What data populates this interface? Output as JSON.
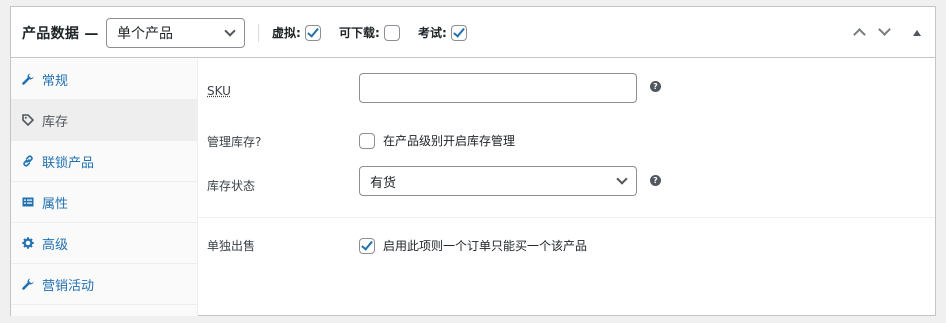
{
  "header": {
    "title": "产品数据 —",
    "product_type": "单个产品",
    "virtual_label": "虚拟:",
    "virtual_checked": true,
    "downloadable_label": "可下载:",
    "downloadable_checked": false,
    "test_label": "考试:",
    "test_checked": true
  },
  "sidebar": {
    "items": [
      {
        "label": "常规",
        "icon": "wrench-icon",
        "active": false
      },
      {
        "label": "库存",
        "icon": "tag-icon",
        "active": true
      },
      {
        "label": "联锁产品",
        "icon": "link-icon",
        "active": false
      },
      {
        "label": "属性",
        "icon": "list-icon",
        "active": false
      },
      {
        "label": "高级",
        "icon": "gear-icon",
        "active": false
      },
      {
        "label": "营销活动",
        "icon": "wrench-icon",
        "active": false
      }
    ]
  },
  "inventory": {
    "sku_label": "SKU",
    "sku_value": "",
    "manage_stock_label": "管理库存?",
    "manage_stock_text": "在产品级别开启库存管理",
    "manage_stock_checked": false,
    "stock_status_label": "库存状态",
    "stock_status_value": "有货",
    "sold_individually_label": "单独出售",
    "sold_individually_text": "启用此项则一个订单只能买一个该产品",
    "sold_individually_checked": true,
    "help_glyph": "?"
  },
  "colors": {
    "link": "#2271b1",
    "border": "#c3c4c7"
  }
}
